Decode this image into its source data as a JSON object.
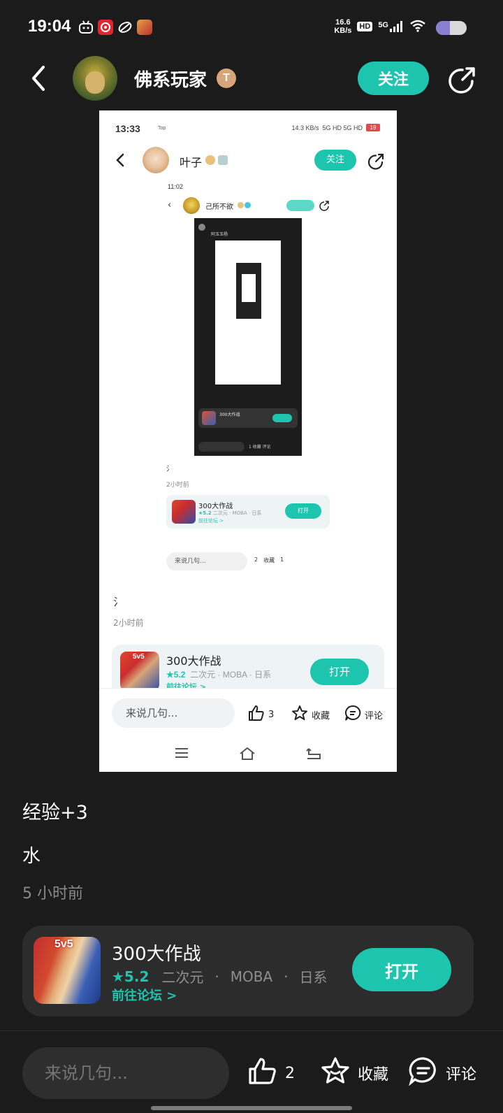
{
  "status_bar": {
    "time": "19:04",
    "net_speed_top": "16.6",
    "net_speed_bottom": "KB/s",
    "hd": "HD",
    "signal": "5G",
    "battery_level": 0.45,
    "app_icons": [
      "bilibili-icon",
      "netease-music-icon",
      "swirl-app-icon",
      "game-app-icon"
    ]
  },
  "header": {
    "username": "佛系玩家",
    "badge": "T",
    "follow_label": "关注"
  },
  "screenshot": {
    "time": "13:33",
    "top_label": "Top",
    "net": "14.3 KB/s",
    "signal": "5G HD 5G HD",
    "battery": "19",
    "username": "叶子",
    "follow_label": "关注",
    "nested": {
      "time": "11:02",
      "username": "己所不欲",
      "follow_label": "关注",
      "inner_name": "阿玉玉杨",
      "inner_game": "300大作战",
      "inner_actions": "1   收藏  评论",
      "tag": "氵",
      "time_ago": "2小时前",
      "game_title": "300大作战",
      "rating": "★5.2",
      "meta": "二次元 · MOBA · 日系",
      "forum_link": "前往论坛 >",
      "open_label": "打开",
      "comment_placeholder": "来说几句...",
      "like_count": "2",
      "favorite_label": "收藏",
      "comment_count": "1"
    },
    "tag": "氵",
    "time_ago": "2小时前",
    "game_title": "300大作战",
    "game_icon_text": "5v5",
    "rating": "★5.2",
    "meta": "二次元 · MOBA · 日系",
    "forum_link": "前往论坛 >",
    "open_label": "打开",
    "comment_placeholder": "来说几句...",
    "like_count": "3",
    "favorite_label": "收藏",
    "comment_label": "评论"
  },
  "post": {
    "exp_text": "经验+3",
    "body": "水",
    "time_ago": "5 小时前"
  },
  "game_card": {
    "icon_text": "5v5",
    "title": "300大作战",
    "rating": "★5.2",
    "tags": [
      "二次元",
      "MOBA",
      "日系"
    ],
    "forum_link": "前往论坛 >",
    "open_label": "打开"
  },
  "bottom_bar": {
    "comment_placeholder": "来说几句...",
    "like_count": "2",
    "favorite_label": "收藏",
    "comment_label": "评论"
  },
  "colors": {
    "accent": "#1ec5ae",
    "background": "#1b1b1b",
    "card": "#2c2c2c"
  }
}
